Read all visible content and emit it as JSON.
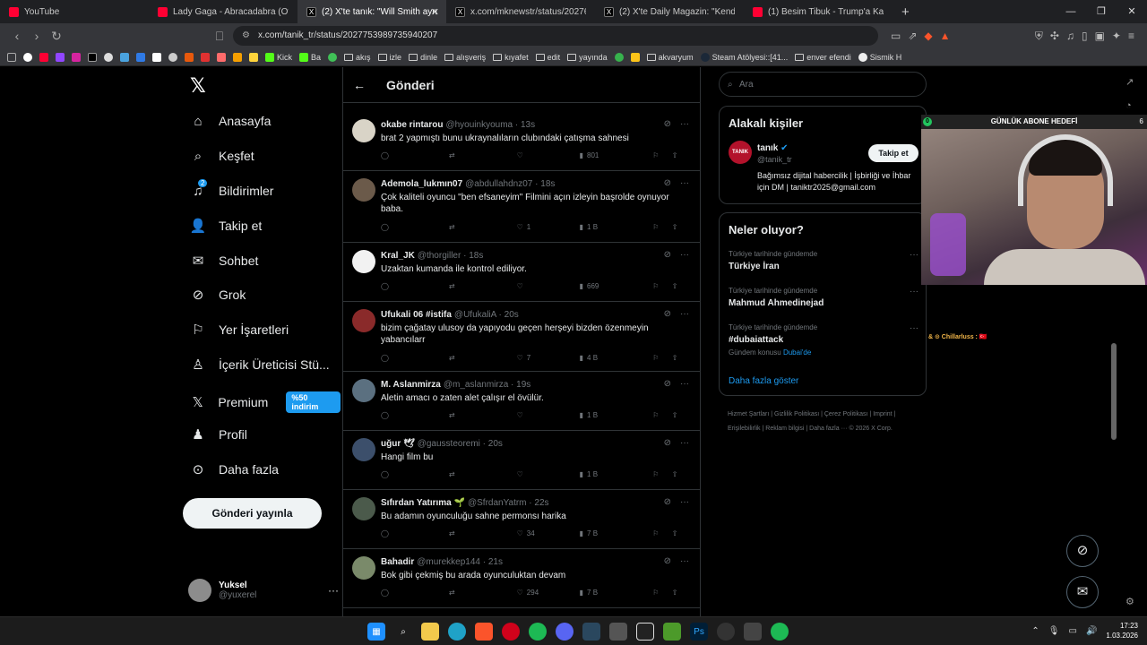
{
  "browser": {
    "tabs": [
      {
        "title": "YouTube",
        "type": "yt",
        "active": false
      },
      {
        "title": "Lady Gaga - Abracadabra (Official M",
        "type": "yt",
        "active": false
      },
      {
        "title": "(2) X'te tanık: \"Will Smith aynı an",
        "type": "x",
        "active": true
      },
      {
        "title": "x.com/mknewstr/status/202769023",
        "type": "x",
        "active": false
      },
      {
        "title": "(2) X'te Daily Magazin: \"Kendall Jenn",
        "type": "x",
        "active": false
      },
      {
        "title": "(1) Besim Tibuk - Trump'a Kayıyor O",
        "type": "yt",
        "active": false
      }
    ],
    "url": "x.com/tanik_tr/status/2027753989735940207",
    "bookmarks": [
      "Kick",
      "Ba",
      "akış",
      "izle",
      "dinle",
      "alışveriş",
      "kıyafet",
      "edit",
      "yayında",
      "akvaryum",
      "Steam Atölyesi::[41...",
      "enver efendi",
      "Sismik H"
    ]
  },
  "nav": {
    "items": [
      {
        "label": "Anasayfa",
        "icon": "home-icon"
      },
      {
        "label": "Keşfet",
        "icon": "search-icon"
      },
      {
        "label": "Bildirimler",
        "icon": "bell-icon",
        "badge": "2"
      },
      {
        "label": "Takip et",
        "icon": "add-user-icon"
      },
      {
        "label": "Sohbet",
        "icon": "mail-icon"
      },
      {
        "label": "Grok",
        "icon": "grok-icon"
      },
      {
        "label": "Yer İşaretleri",
        "icon": "bookmark-icon"
      },
      {
        "label": "İçerik Üreticisi Stü...",
        "icon": "creator-icon"
      },
      {
        "label": "Premium",
        "icon": "x-icon",
        "promo": "%50 indirim"
      },
      {
        "label": "Profil",
        "icon": "person-icon"
      },
      {
        "label": "Daha fazla",
        "icon": "more-circle-icon"
      }
    ],
    "post_button": "Gönderi yayınla",
    "account": {
      "name": "Yuksel",
      "handle": "@yuxerel"
    }
  },
  "feed": {
    "title": "Gönderi",
    "replies": [
      {
        "name": "okabe rintarou",
        "handle": "@hyouinkyouma · 13s",
        "text": "brat 2 yapmıştı bunu ukraynalıların clubındaki çatışma sahnesi",
        "likes": "",
        "views": "801",
        "avatar": "#d9d4c7"
      },
      {
        "name": "Ademola_lukmın07",
        "handle": "@abdullahdnz07 · 18s",
        "text": "Çok kaliteli oyuncu \"ben efsaneyim\" Filmini açın izleyin başrolde oynuyor baba.",
        "likes": "1",
        "views": "1 B",
        "avatar": "#6b5a4a"
      },
      {
        "name": "Kral_JK",
        "handle": "@thorgiller · 18s",
        "text": "Uzaktan kumanda ile kontrol ediliyor.",
        "likes": "",
        "views": "669",
        "avatar": "#f2f2f2"
      },
      {
        "name": "Ufukali 06 #istifa",
        "handle": "@UfukaliA · 20s",
        "text": "bizim çağatay ulusoy da yapıyodu geçen herşeyi bizden özenmeyin yabancılarr",
        "likes": "7",
        "views": "4 B",
        "avatar": "#8a2a2a"
      },
      {
        "name": "M. Aslanmirza",
        "handle": "@m_aslanmirza · 19s",
        "text": "Aletin amacı o zaten alet çalışır el övülür.",
        "likes": "",
        "views": "1 B",
        "avatar": "#5b7080"
      },
      {
        "name": "uğur 🕊",
        "handle": "@gaussteoremi · 20s",
        "text": "Hangi film bu",
        "likes": "",
        "views": "1 B",
        "avatar": "#3c4f6b"
      },
      {
        "name": "Sıfırdan Yatırıma 🌱",
        "handle": "@SfrdanYatrm · 22s",
        "text": "Bu adamın oyunculuğu sahne permonsı harika",
        "likes": "34",
        "views": "7 B",
        "avatar": "#4b5a4b"
      },
      {
        "name": "Bahadir",
        "handle": "@murekkep144 · 21s",
        "text": "Bok gibi çekmiş bu arada oyunculuktan devam",
        "likes": "294",
        "views": "7 B",
        "avatar": "#7a8a6a"
      }
    ]
  },
  "right": {
    "search_placeholder": "Ara",
    "related": {
      "title": "Alakalı kişiler",
      "name": "tanık",
      "handle": "@tanik_tr",
      "avatar_text": "TANIK",
      "follow": "Takip et",
      "bio": "Bağımsız dijital habercilik | İşbirliği ve İhbar için DM | taniktr2025@gmail.com"
    },
    "trends": {
      "title": "Neler oluyor?",
      "items": [
        {
          "context": "Türkiye tarihinde gündemde",
          "topic": "Türkiye İran",
          "sub": "",
          "sub_link": ""
        },
        {
          "context": "Türkiye tarihinde gündemde",
          "topic": "Mahmud Ahmedinejad",
          "sub": "",
          "sub_link": ""
        },
        {
          "context": "Türkiye tarihinde gündemde",
          "topic": "#dubaiattack",
          "sub": "Gündem konusu",
          "sub_link": "Dubai'de"
        }
      ],
      "show_more": "Daha fazla göster"
    },
    "footer": "Hizmet Şartları | Gizlilik Politikası | Çerez Politikası | Imprint | Erişilebilirlik | Reklam bilgisi | Daha fazla ··· © 2026 X Corp."
  },
  "overlay": {
    "goal_title": "GÜNLÜK ABONE HEDEFİ",
    "goal_current": "0",
    "goal_target": "6",
    "chat": "& ⊙ Chillarluss : 🇹🇷"
  },
  "taskbar": {
    "time": "17:23",
    "date": "1.03.2026"
  },
  "colors": {
    "accent": "#1d9bf0",
    "background": "#000000",
    "border": "#2f3336"
  }
}
